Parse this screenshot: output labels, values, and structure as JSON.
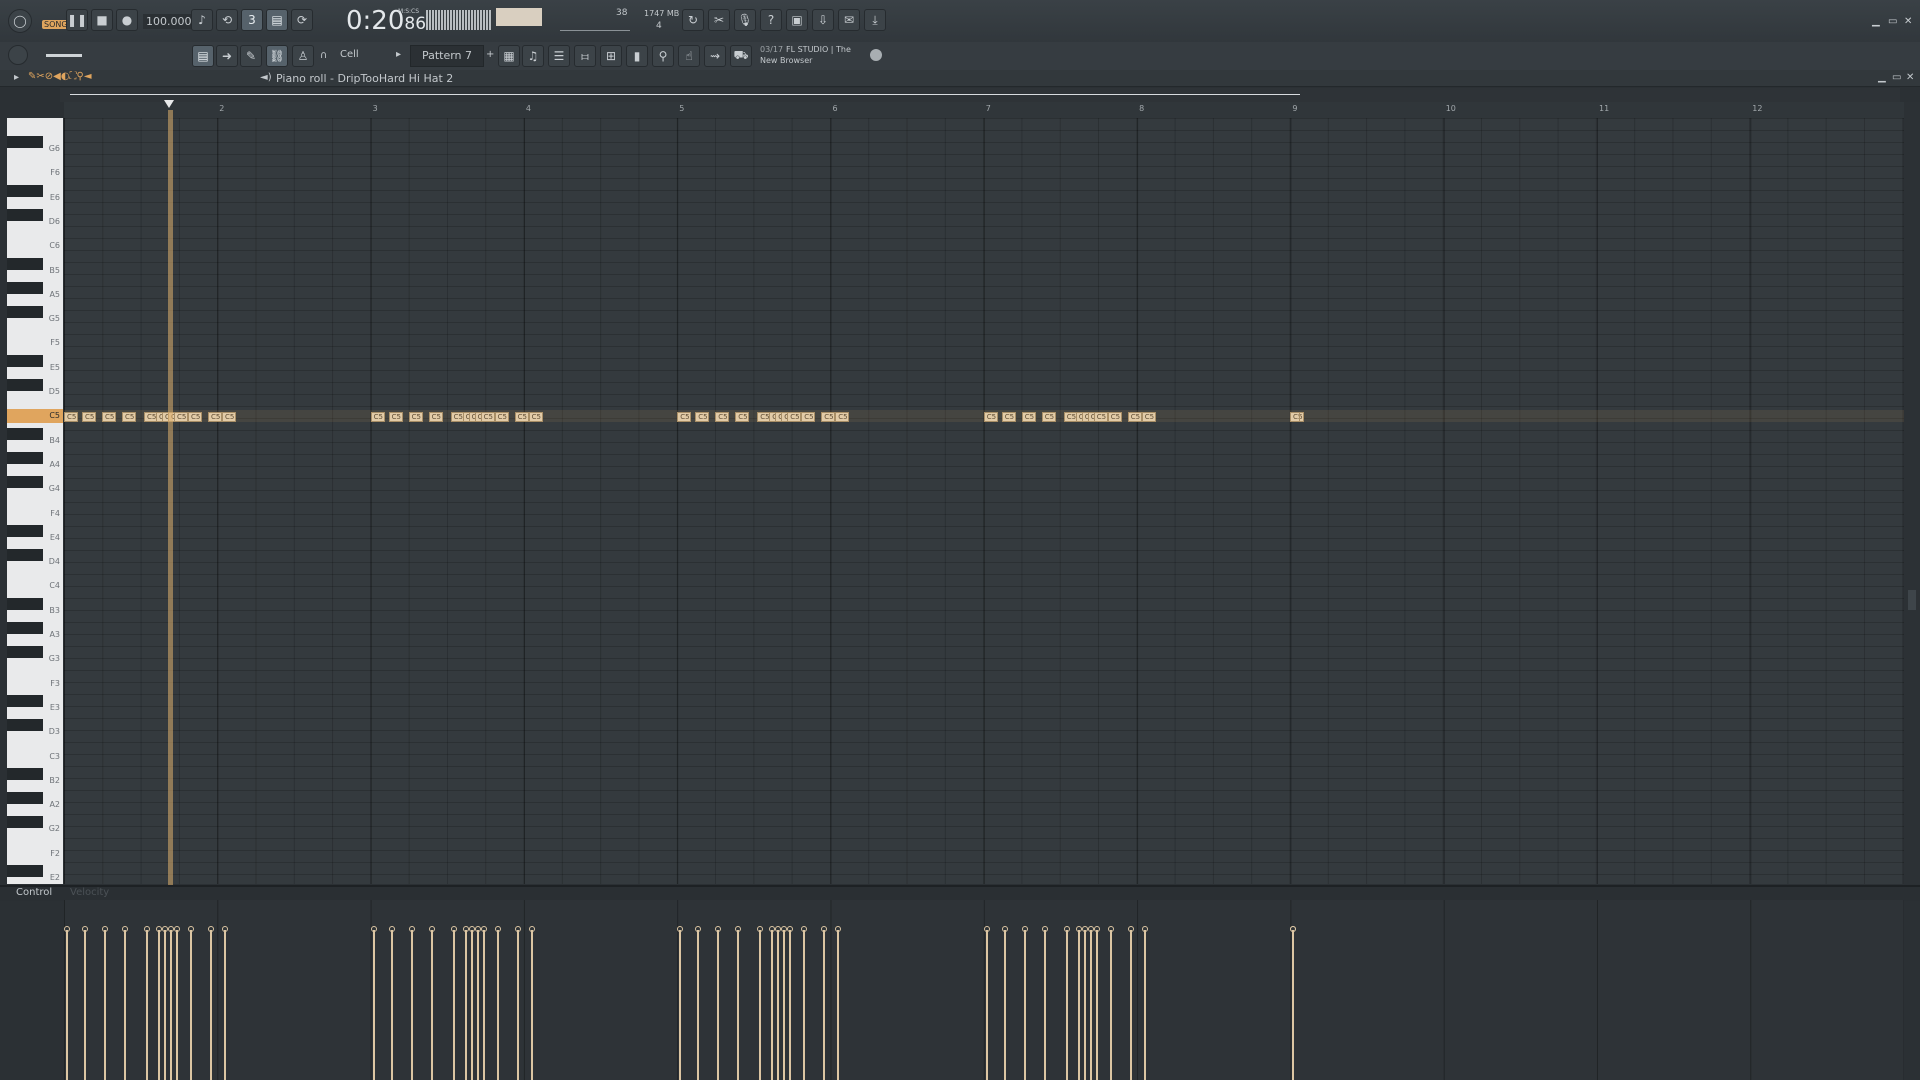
{
  "transport": {
    "song_label": "SONG",
    "tempo": "100.000",
    "time_main": "0:20",
    "time_sub": "86",
    "time_unit": "M:S:CS",
    "cpu_value": "38",
    "memory": "1747 MB",
    "polyphony": "4"
  },
  "toolbar2": {
    "snap": "Cell",
    "pattern": "Pattern 7",
    "news_date": "03/17",
    "news_line1": "FL STUDIO | The",
    "news_line2": "New Browser"
  },
  "pianoroll": {
    "title": "Piano roll - DripTooHard Hi Hat 2",
    "bars": [
      "2",
      "3",
      "4",
      "5",
      "6",
      "7",
      "8",
      "9",
      "10",
      "11",
      "12"
    ],
    "keys": [
      "G6",
      "F6",
      "E6",
      "D6",
      "C6",
      "B5",
      "A5",
      "G5",
      "F5",
      "E5",
      "D5",
      "C5",
      "B4",
      "A4",
      "G4",
      "F4",
      "E4",
      "D4",
      "C4",
      "B3",
      "A3",
      "G3",
      "F3",
      "E3",
      "D3",
      "C3",
      "B2",
      "A2",
      "G2",
      "F2",
      "E2"
    ],
    "highlight_key": "C5",
    "note_label": "C5",
    "control_label": "Control",
    "control_sub": "Velocity"
  },
  "colors": {
    "note": "#e2cba7",
    "note_border": "#a88e66",
    "accent": "#e0a55e"
  }
}
